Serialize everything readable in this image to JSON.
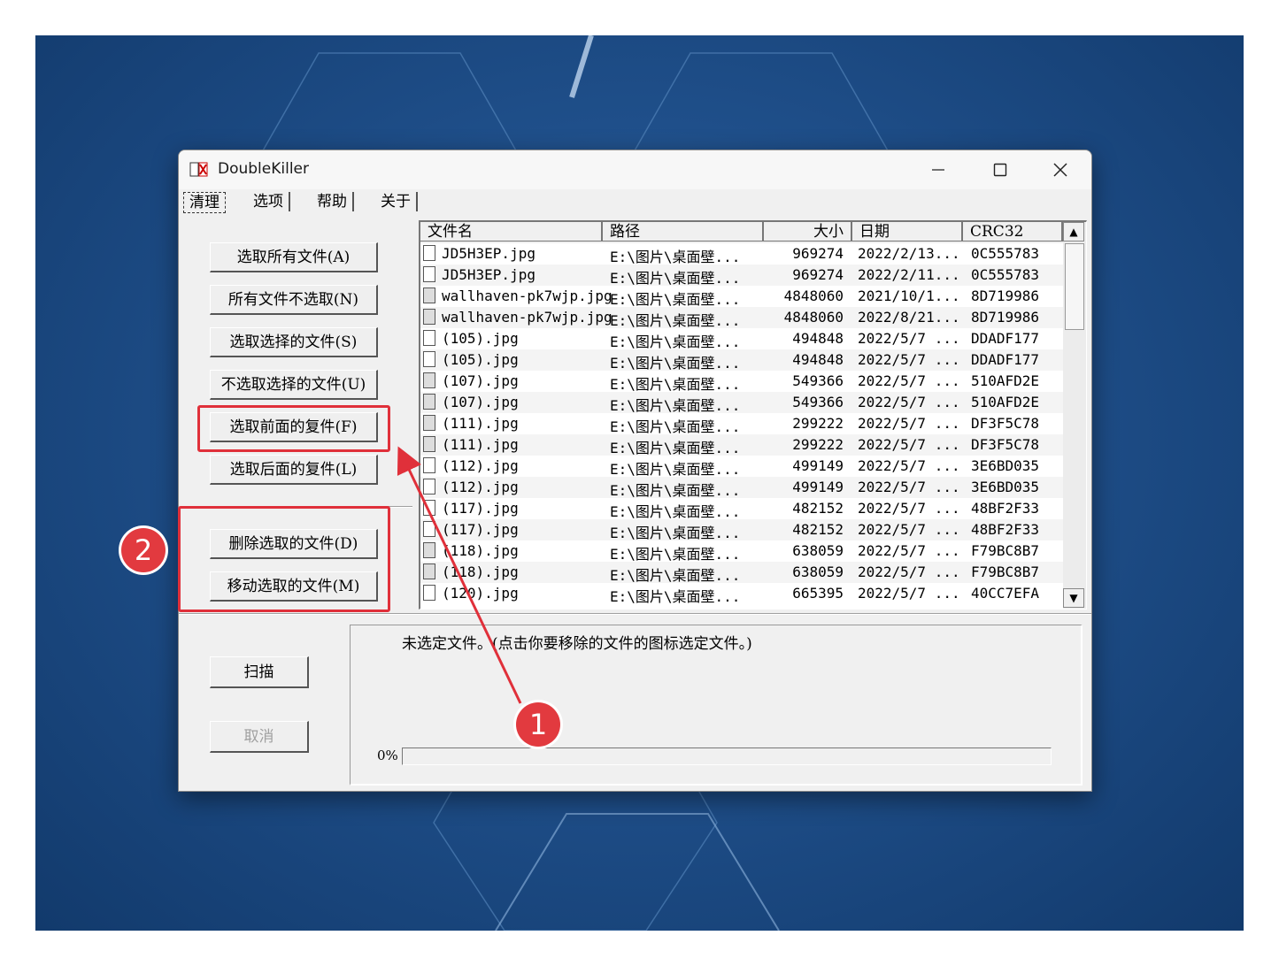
{
  "window": {
    "title": "DoubleKiller"
  },
  "menu": [
    "清理",
    "选项",
    "帮助",
    "关于"
  ],
  "buttons": {
    "select_all": "选取所有文件(A)",
    "deselect_all": "所有文件不选取(N)",
    "select_selected": "选取选择的文件(S)",
    "deselect_selected": "不选取选择的文件(U)",
    "select_front_dup": "选取前面的复件(F)",
    "select_back_dup": "选取后面的复件(L)",
    "delete_selected": "删除选取的文件(D)",
    "move_selected": "移动选取的文件(M)",
    "scan": "扫描",
    "cancel": "取消"
  },
  "columns": [
    "文件名",
    "路径",
    "大小",
    "日期",
    "CRC32"
  ],
  "rows": [
    {
      "name": "JD5H3EP.jpg",
      "path": "E:\\图片\\桌面壁...",
      "size": "969274",
      "date": "2022/2/13...",
      "crc": "0C555783",
      "icon": "white"
    },
    {
      "name": "JD5H3EP.jpg",
      "path": "E:\\图片\\桌面壁...",
      "size": "969274",
      "date": "2022/2/11...",
      "crc": "0C555783",
      "icon": "white"
    },
    {
      "name": "wallhaven-pk7wjp.jpg",
      "path": "E:\\图片\\桌面壁...",
      "size": "4848060",
      "date": "2021/10/1...",
      "crc": "8D719986",
      "icon": "gray"
    },
    {
      "name": "wallhaven-pk7wjp.jpg",
      "path": "E:\\图片\\桌面壁...",
      "size": "4848060",
      "date": "2022/8/21...",
      "crc": "8D719986",
      "icon": "gray"
    },
    {
      "name": "(105).jpg",
      "path": "E:\\图片\\桌面壁...",
      "size": "494848",
      "date": "2022/5/7 ...",
      "crc": "DDADF177",
      "icon": "white"
    },
    {
      "name": "(105).jpg",
      "path": "E:\\图片\\桌面壁...",
      "size": "494848",
      "date": "2022/5/7 ...",
      "crc": "DDADF177",
      "icon": "white"
    },
    {
      "name": "(107).jpg",
      "path": "E:\\图片\\桌面壁...",
      "size": "549366",
      "date": "2022/5/7 ...",
      "crc": "510AFD2E",
      "icon": "gray"
    },
    {
      "name": "(107).jpg",
      "path": "E:\\图片\\桌面壁...",
      "size": "549366",
      "date": "2022/5/7 ...",
      "crc": "510AFD2E",
      "icon": "gray"
    },
    {
      "name": "(111).jpg",
      "path": "E:\\图片\\桌面壁...",
      "size": "299222",
      "date": "2022/5/7 ...",
      "crc": "DF3F5C78",
      "icon": "gray"
    },
    {
      "name": "(111).jpg",
      "path": "E:\\图片\\桌面壁...",
      "size": "299222",
      "date": "2022/5/7 ...",
      "crc": "DF3F5C78",
      "icon": "gray"
    },
    {
      "name": "(112).jpg",
      "path": "E:\\图片\\桌面壁...",
      "size": "499149",
      "date": "2022/5/7 ...",
      "crc": "3E6BD035",
      "icon": "white"
    },
    {
      "name": "(112).jpg",
      "path": "E:\\图片\\桌面壁...",
      "size": "499149",
      "date": "2022/5/7 ...",
      "crc": "3E6BD035",
      "icon": "white"
    },
    {
      "name": "(117).jpg",
      "path": "E:\\图片\\桌面壁...",
      "size": "482152",
      "date": "2022/5/7 ...",
      "crc": "48BF2F33",
      "icon": "white"
    },
    {
      "name": "(117).jpg",
      "path": "E:\\图片\\桌面壁...",
      "size": "482152",
      "date": "2022/5/7 ...",
      "crc": "48BF2F33",
      "icon": "white"
    },
    {
      "name": "(118).jpg",
      "path": "E:\\图片\\桌面壁...",
      "size": "638059",
      "date": "2022/5/7 ...",
      "crc": "F79BC8B7",
      "icon": "gray"
    },
    {
      "name": "(118).jpg",
      "path": "E:\\图片\\桌面壁...",
      "size": "638059",
      "date": "2022/5/7 ...",
      "crc": "F79BC8B7",
      "icon": "gray"
    },
    {
      "name": "(120).jpg",
      "path": "E:\\图片\\桌面壁...",
      "size": "665395",
      "date": "2022/5/7 ...",
      "crc": "40CC7EFA",
      "icon": "white"
    }
  ],
  "status": {
    "message": "未选定文件。(点击你要移除的文件的图标选定文件。)",
    "progress_label": "0%",
    "progress": 0
  },
  "annotations": {
    "badge1": "1",
    "badge2": "2",
    "highlight_color": "#e0303a"
  }
}
